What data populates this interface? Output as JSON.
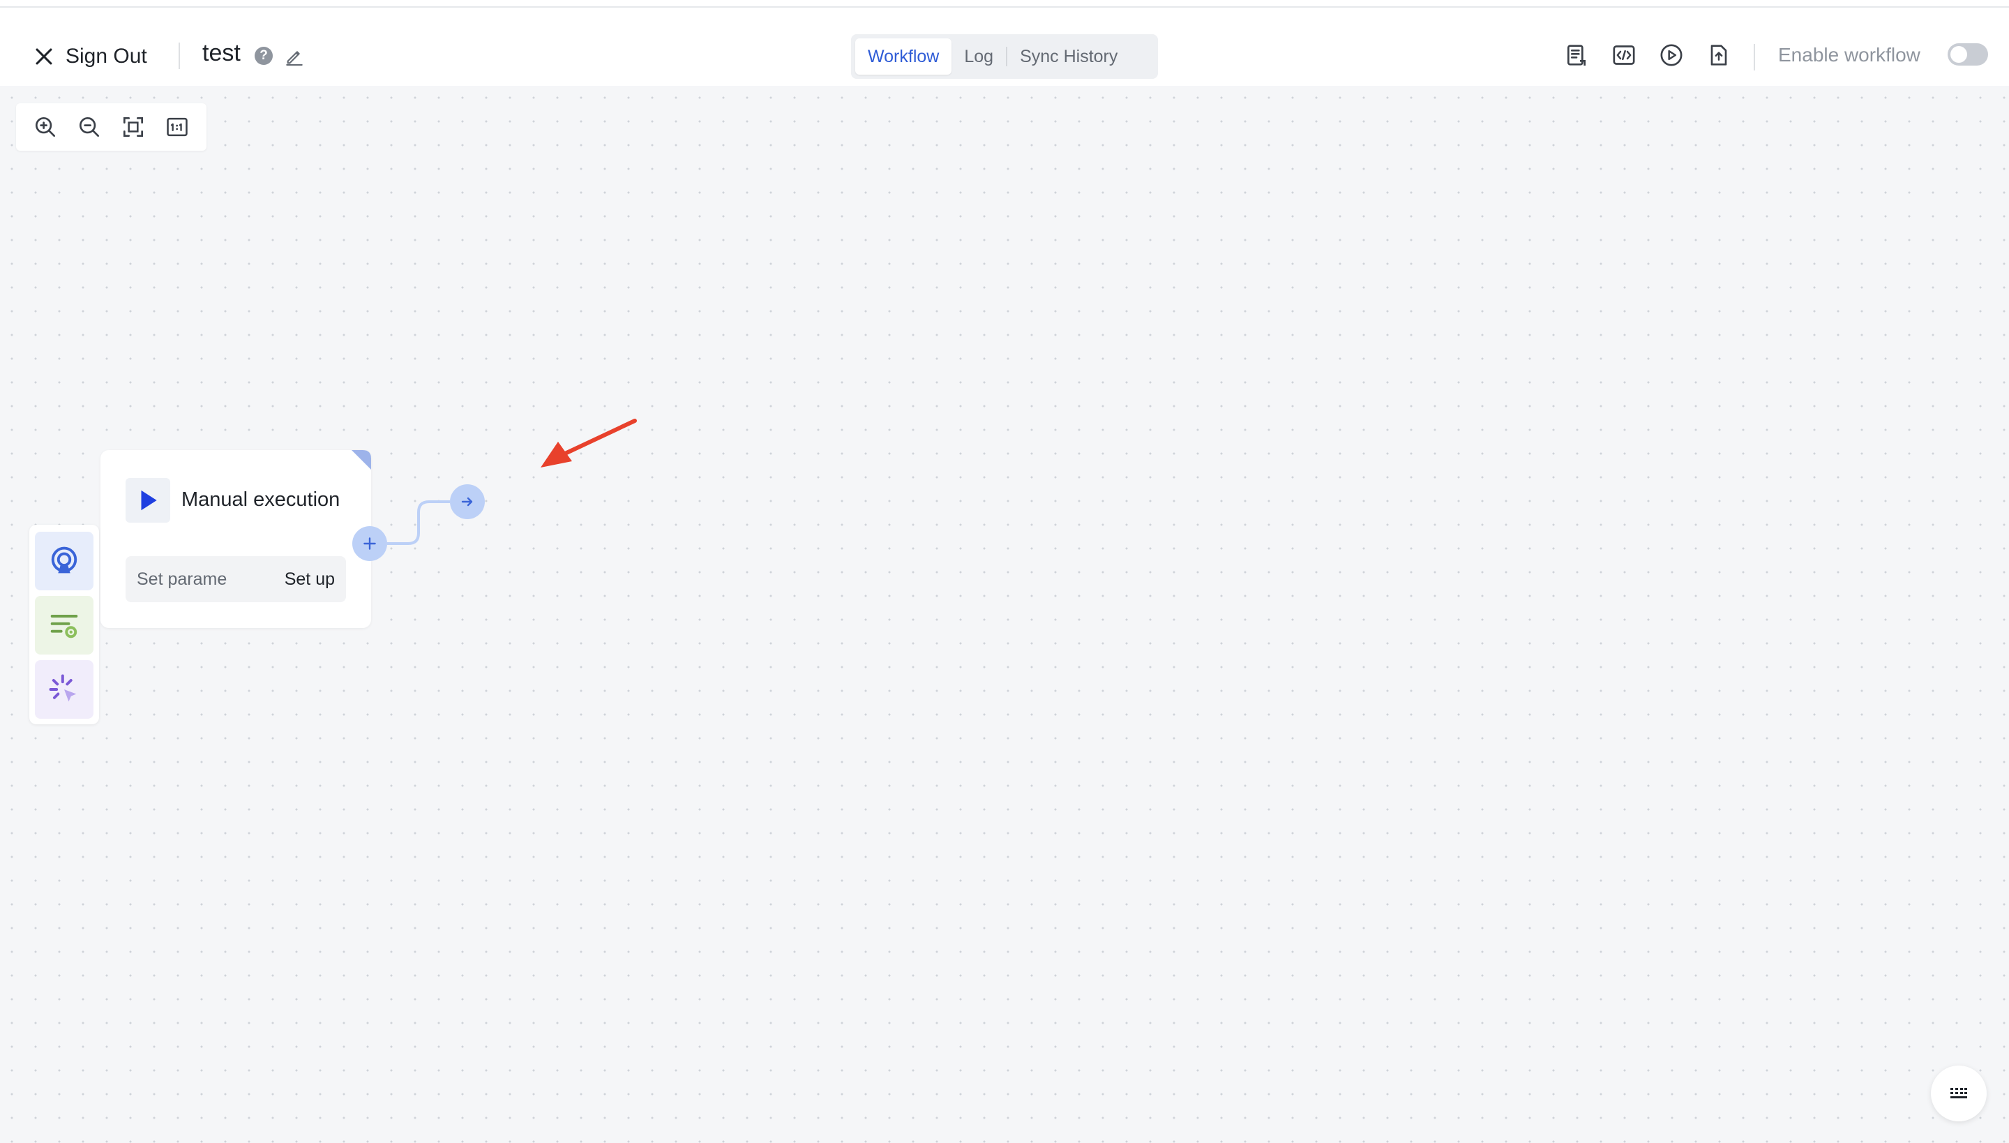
{
  "header": {
    "signout_label": "Sign Out",
    "title": "test",
    "tabs": [
      {
        "label": "Workflow",
        "active": true
      },
      {
        "label": "Log",
        "active": false
      },
      {
        "label": "Sync History",
        "active": false
      }
    ],
    "tools": [
      "document-icon",
      "code-icon",
      "play-circle-icon",
      "export-icon"
    ],
    "enable_label": "Enable workflow",
    "enabled": false
  },
  "canvas": {
    "zoom_tools": [
      "zoom-in-icon",
      "zoom-out-icon",
      "fit-view-icon",
      "actual-size-icon"
    ],
    "side_tools": [
      "trigger-icon",
      "settings-list-icon",
      "ai-sparkle-icon"
    ]
  },
  "node": {
    "title": "Manual execution",
    "param_label": "Set parame",
    "setup_label": "Set up"
  },
  "colors": {
    "accent": "#2f5cd6",
    "node_play": "#1f3fe0",
    "connector": "#bcd0f7",
    "annotation_arrow": "#e8412c"
  }
}
